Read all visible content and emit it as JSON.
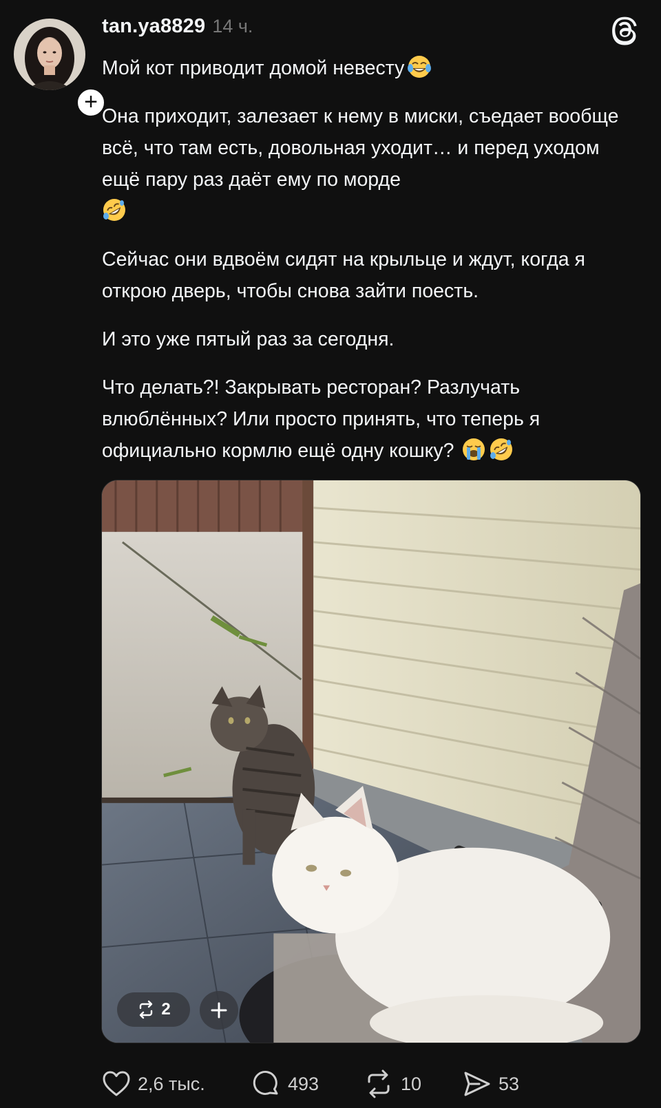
{
  "post": {
    "username": "tan.ya8829",
    "timestamp": "14 ч.",
    "paragraphs": [
      "Мой кот приводит домой невесту",
      "Она приходит, залезает к нему в миски, съедает вообще всё, что там есть, довольная уходит… и перед уходом ещё пару раз даёт ему по морде",
      "Сейчас они вдвоём сидят на крыльце и ждут, когда я открою дверь, чтобы снова зайти поесть.",
      "И это уже пятый раз за сегодня.",
      "Что делать?! Закрывать ресторан? Разлучать влюблённых? Или просто принять, что теперь я официально кормлю ещё одну кошку?"
    ],
    "emojis": [
      "face-with-tears-of-joy-emoji",
      "rolling-on-floor-laughing-emoji",
      "loudly-crying-face-emoji",
      "rolling-on-floor-laughing-emoji"
    ]
  },
  "media": {
    "repost_count": "2"
  },
  "actions": {
    "likes": "2,6 тыс.",
    "comments": "493",
    "reposts": "10",
    "shares": "53"
  },
  "icons": {
    "logo": "threads-logo-icon",
    "like": "heart-icon",
    "comment": "comment-bubble-icon",
    "repost": "repost-icon",
    "share": "send-icon",
    "follow": "plus-icon"
  },
  "colors": {
    "background": "#101010",
    "text": "#f3f5f7",
    "muted": "#777777"
  }
}
